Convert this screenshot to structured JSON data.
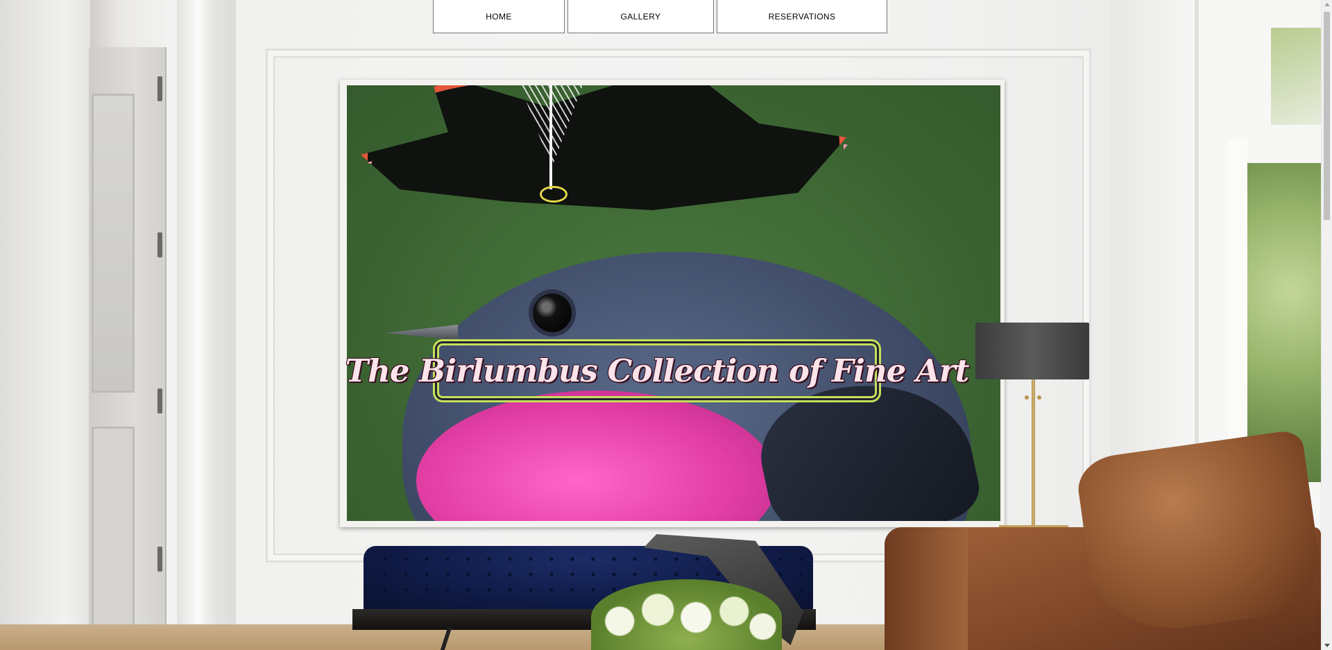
{
  "nav": {
    "home": "HOME",
    "gallery": "GALLERY",
    "reservations": "RESERVATIONS"
  },
  "hero": {
    "title": "The Birlumbus Collection of Fine Art"
  },
  "colors": {
    "title_border": "#c6e05a",
    "title_text": "#fbe3ea",
    "nav_background": "#ffffff"
  },
  "icons": {
    "scroll_up": "triangle-up",
    "scroll_down": "triangle-down"
  }
}
